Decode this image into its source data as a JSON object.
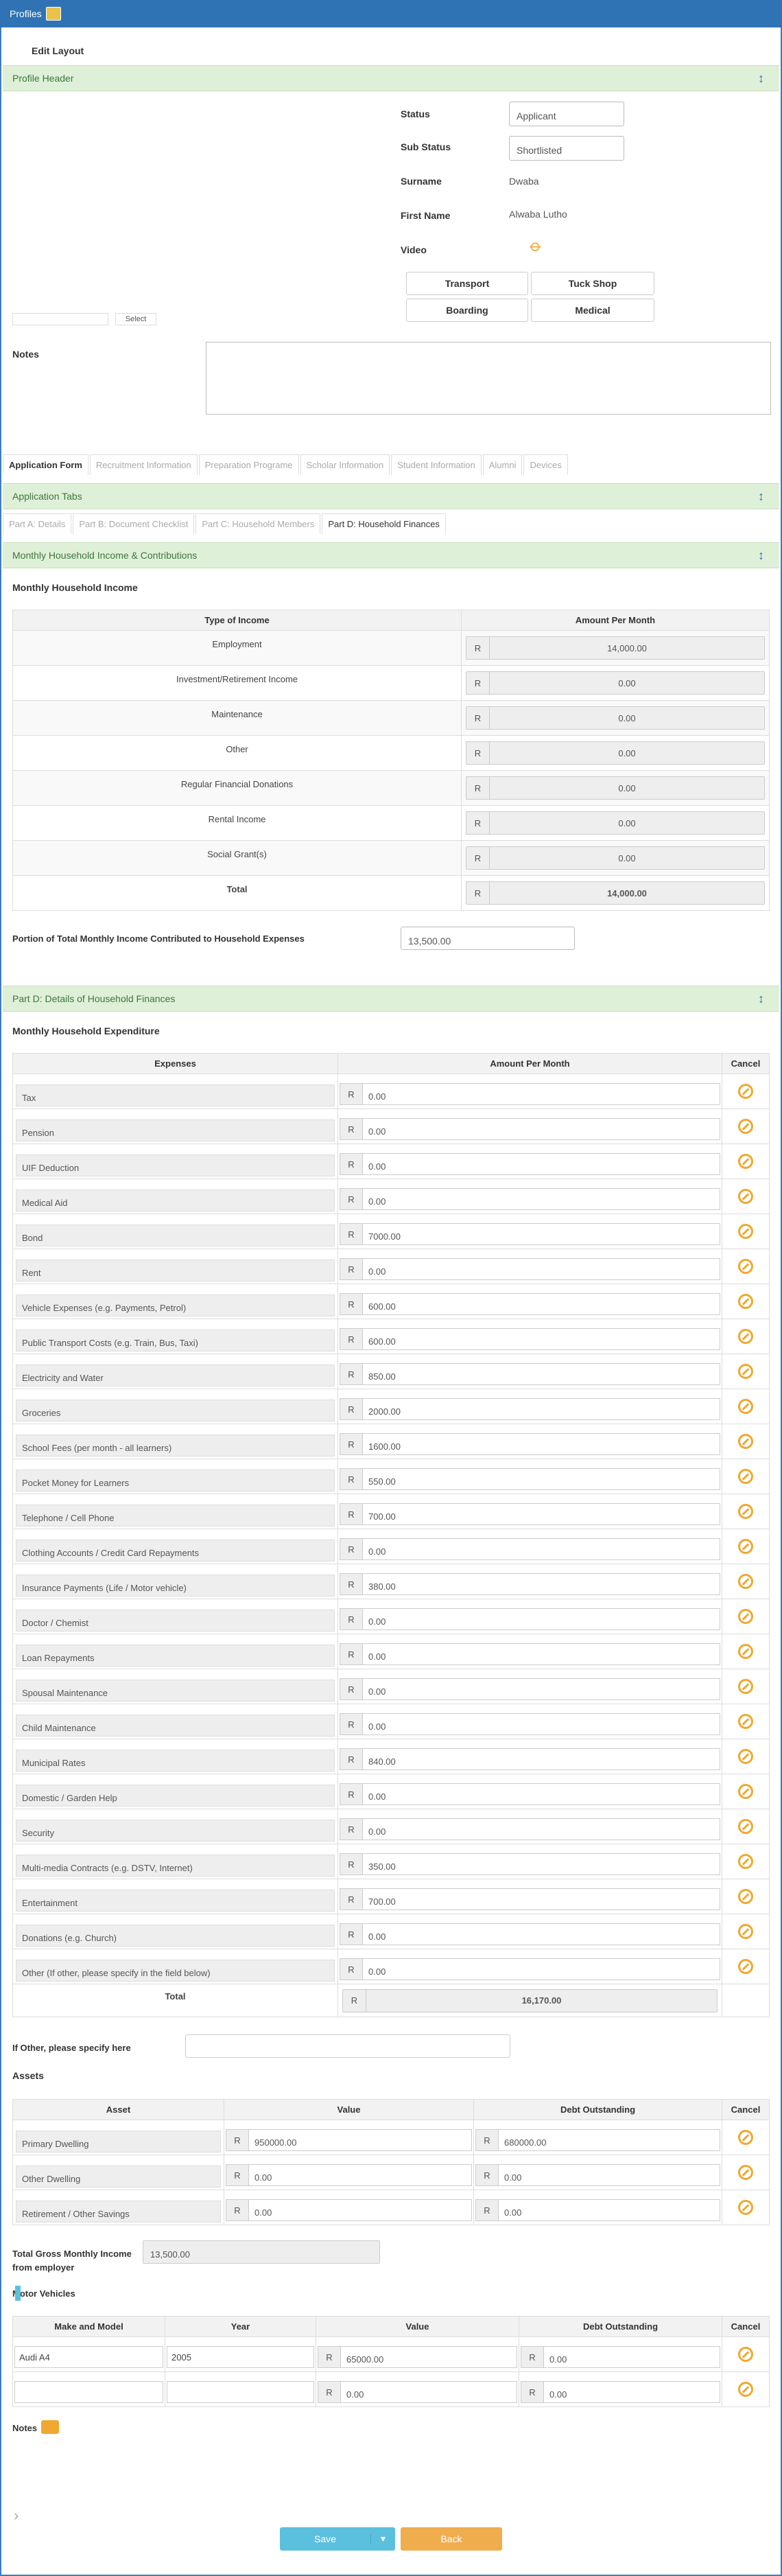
{
  "topbar": {
    "title": "Profiles"
  },
  "layout": {
    "edit": "Edit Layout"
  },
  "profile_header": {
    "title": "Profile Header",
    "status_label": "Status",
    "status_value": "Applicant",
    "substatus_label": "Sub Status",
    "substatus_value": "Shortlisted",
    "surname_label": "Surname",
    "surname_value": "Dwaba",
    "firstname_label": "First Name",
    "firstname_value": "Alwaba Lutho",
    "video_label": "Video",
    "select_label": "Select",
    "notes_label": "Notes",
    "buttons": [
      "Transport",
      "Tuck Shop",
      "Boarding",
      "Medical"
    ]
  },
  "main_tabs": [
    {
      "label": "Application Form"
    },
    {
      "label": "Recruitment Information"
    },
    {
      "label": "Preparation Programe"
    },
    {
      "label": "Scholar Information"
    },
    {
      "label": "Student Information"
    },
    {
      "label": "Alumni"
    },
    {
      "label": "Devices"
    }
  ],
  "app_tabs": {
    "title": "Application Tabs",
    "items": [
      {
        "label": "Part A: Details"
      },
      {
        "label": "Part B: Document Checklist"
      },
      {
        "label": "Part C: Household Members"
      },
      {
        "label": "Part D: Household Finances"
      }
    ]
  },
  "income": {
    "panel_title": "Monthly Household Income & Contributions",
    "heading": "Monthly Household Income",
    "col_type": "Type of Income",
    "col_amount": "Amount Per Month",
    "currency": "R",
    "rows": [
      {
        "type": "Employment",
        "amount": "14,000.00"
      },
      {
        "type": "Investment/Retirement Income",
        "amount": "0.00"
      },
      {
        "type": "Maintenance",
        "amount": "0.00"
      },
      {
        "type": "Other",
        "amount": "0.00"
      },
      {
        "type": "Regular Financial Donations",
        "amount": "0.00"
      },
      {
        "type": "Rental Income",
        "amount": "0.00"
      },
      {
        "type": "Social Grant(s)",
        "amount": "0.00"
      }
    ],
    "total_label": "Total",
    "total_amount": "14,000.00",
    "portion_label": "Portion of Total Monthly Income Contributed to Household Expenses",
    "portion_value": "13,500.00"
  },
  "expenditure": {
    "panel_title": "Part D: Details of Household Finances",
    "heading": "Monthly Household Expenditure",
    "col_expenses": "Expenses",
    "col_amount": "Amount Per Month",
    "col_cancel": "Cancel",
    "rows": [
      {
        "label": "Tax",
        "value": "0.00"
      },
      {
        "label": "Pension",
        "value": "0.00"
      },
      {
        "label": "UIF Deduction",
        "value": "0.00"
      },
      {
        "label": "Medical Aid",
        "value": "0.00"
      },
      {
        "label": "Bond",
        "value": "7000.00"
      },
      {
        "label": "Rent",
        "value": "0.00"
      },
      {
        "label": "Vehicle Expenses (e.g. Payments, Petrol)",
        "value": "600.00"
      },
      {
        "label": "Public Transport Costs (e.g. Train, Bus, Taxi)",
        "value": "600.00"
      },
      {
        "label": "Electricity and Water",
        "value": "850.00"
      },
      {
        "label": "Groceries",
        "value": "2000.00"
      },
      {
        "label": "School Fees (per month - all learners)",
        "value": "1600.00"
      },
      {
        "label": "Pocket Money for Learners",
        "value": "550.00"
      },
      {
        "label": "Telephone / Cell Phone",
        "value": "700.00"
      },
      {
        "label": "Clothing Accounts / Credit Card Repayments",
        "value": "0.00"
      },
      {
        "label": "Insurance Payments (Life / Motor vehicle)",
        "value": "380.00"
      },
      {
        "label": "Doctor / Chemist",
        "value": "0.00"
      },
      {
        "label": "Loan Repayments",
        "value": "0.00"
      },
      {
        "label": "Spousal Maintenance",
        "value": "0.00"
      },
      {
        "label": "Child Maintenance",
        "value": "0.00"
      },
      {
        "label": "Municipal Rates",
        "value": "840.00"
      },
      {
        "label": "Domestic / Garden Help",
        "value": "0.00"
      },
      {
        "label": "Security",
        "value": "0.00"
      },
      {
        "label": "Multi-media Contracts (e.g. DSTV, Internet)",
        "value": "350.00"
      },
      {
        "label": "Entertainment",
        "value": "700.00"
      },
      {
        "label": "Donations (e.g. Church)",
        "value": "0.00"
      },
      {
        "label": "Other (If other, please specify in the field below)",
        "value": "0.00"
      }
    ],
    "total_label": "Total",
    "total_value": "16,170.00",
    "other_label": "If Other, please specify here"
  },
  "assets": {
    "heading": "Assets",
    "col_asset": "Asset",
    "col_value": "Value",
    "col_debt": "Debt Outstanding",
    "col_cancel": "Cancel",
    "rows": [
      {
        "asset": "Primary Dwelling",
        "value": "950000.00",
        "debt": "680000.00"
      },
      {
        "asset": "Other Dwelling",
        "value": "0.00",
        "debt": "0.00"
      },
      {
        "asset": "Retirement / Other Savings",
        "value": "0.00",
        "debt": "0.00"
      }
    ],
    "gross_label": "Total Gross Monthly Income from employer",
    "gross_value": "13,500.00"
  },
  "vehicles": {
    "heading": "Motor Vehicles",
    "col_make": "Make and Model",
    "col_year": "Year",
    "col_value": "Value",
    "col_debt": "Debt Outstanding",
    "col_cancel": "Cancel",
    "rows": [
      {
        "make": "Audi A4",
        "year": "2005",
        "value": "65000.00",
        "debt": "0.00"
      },
      {
        "make": "",
        "year": "",
        "value": "0.00",
        "debt": "0.00"
      }
    ]
  },
  "notes2": {
    "label": "Notes"
  },
  "actions": {
    "save": "Save",
    "back": "Back"
  }
}
